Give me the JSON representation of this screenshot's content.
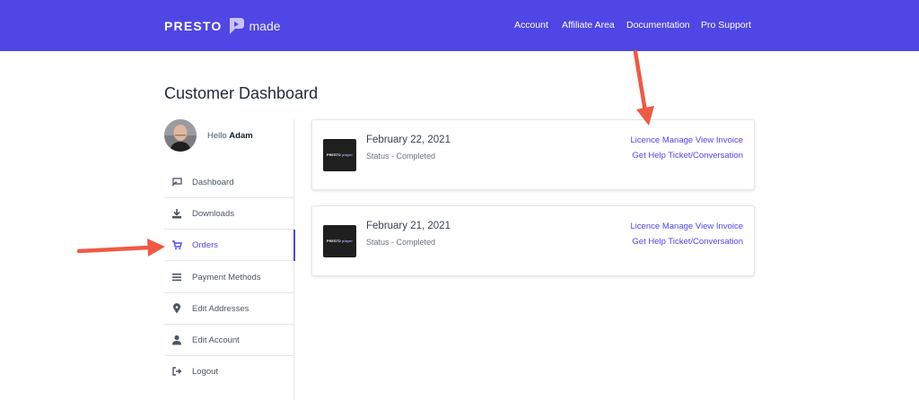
{
  "header": {
    "logo": {
      "presto": "PRESTO",
      "made": "made"
    },
    "nav": [
      "Account",
      "Affiliate Area",
      "Documentation",
      "Pro Support"
    ]
  },
  "page_title": "Customer Dashboard",
  "sidebar": {
    "greeting": "Hello",
    "user_name": "Adam",
    "items": [
      {
        "label": "Dashboard",
        "icon": "dashboard-icon"
      },
      {
        "label": "Downloads",
        "icon": "download-icon"
      },
      {
        "label": "Orders",
        "icon": "cart-icon",
        "active": true
      },
      {
        "label": "Payment Methods",
        "icon": "list-icon"
      },
      {
        "label": "Edit Addresses",
        "icon": "map-pin-icon"
      },
      {
        "label": "Edit Account",
        "icon": "user-icon"
      },
      {
        "label": "Logout",
        "icon": "logout-icon"
      }
    ]
  },
  "orders": [
    {
      "date": "February 22, 2021",
      "status": "Status - Completed",
      "thumb": {
        "brand": "PRESTO",
        "sub": "player"
      },
      "links": [
        "Licence Manage",
        "View",
        "Invoice",
        "Get Help",
        "Ticket/Conversation"
      ]
    },
    {
      "date": "February 21, 2021",
      "status": "Status - Completed",
      "thumb": {
        "brand": "PRESTO",
        "sub": "player"
      },
      "links": [
        "Licence Manage",
        "View",
        "Invoice",
        "Get Help",
        "Ticket/Conversation"
      ]
    }
  ],
  "colors": {
    "brand": "#4f46e5",
    "annotation_arrow": "#ef5a43"
  }
}
